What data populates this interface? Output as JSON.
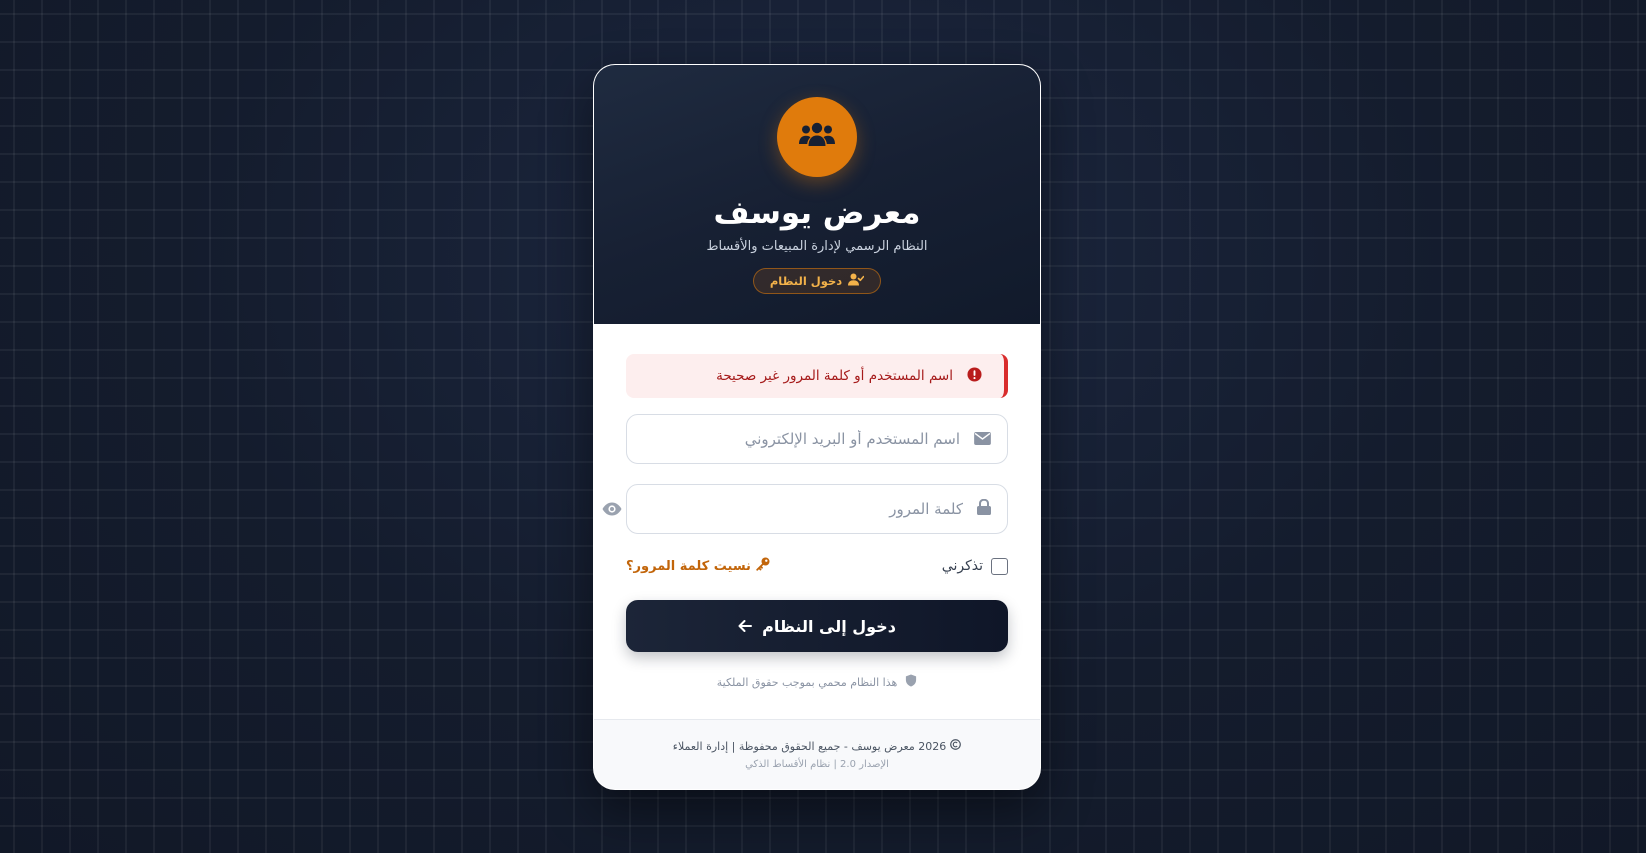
{
  "brand": {
    "title": "معرض يوسف",
    "subtitle": "النظام الرسمي لإدارة المبيعات والأقساط",
    "badge_label": "دخول النظام",
    "logo_icon": "users-group-icon",
    "accent_color": "#e07b0c"
  },
  "alert": {
    "message": "اسم المستخدم أو كلمة المرور غير صحيحة",
    "icon": "exclamation-circle-icon",
    "color": "#d92c2c"
  },
  "form": {
    "username_placeholder": "اسم المستخدم أو البريد الإلكتروني",
    "username_icon": "envelope-icon",
    "password_placeholder": "كلمة المرور",
    "password_icon": "lock-icon",
    "password_toggle_icon": "eye-icon",
    "remember_label": "تذكرني",
    "forgot_label": "نسيت كلمة المرور؟",
    "forgot_icon": "key-icon",
    "submit_label": "دخول إلى النظام",
    "submit_icon": "arrow-left-icon"
  },
  "protected_note": "هذا النظام محمي بموجب حقوق الملكية",
  "footer": {
    "copyright": "2026 معرض يوسف - جميع الحقوق محفوظة | إدارة العملاء",
    "version": "الإصدار 2.0 | نظام الأقساط الذكي"
  }
}
